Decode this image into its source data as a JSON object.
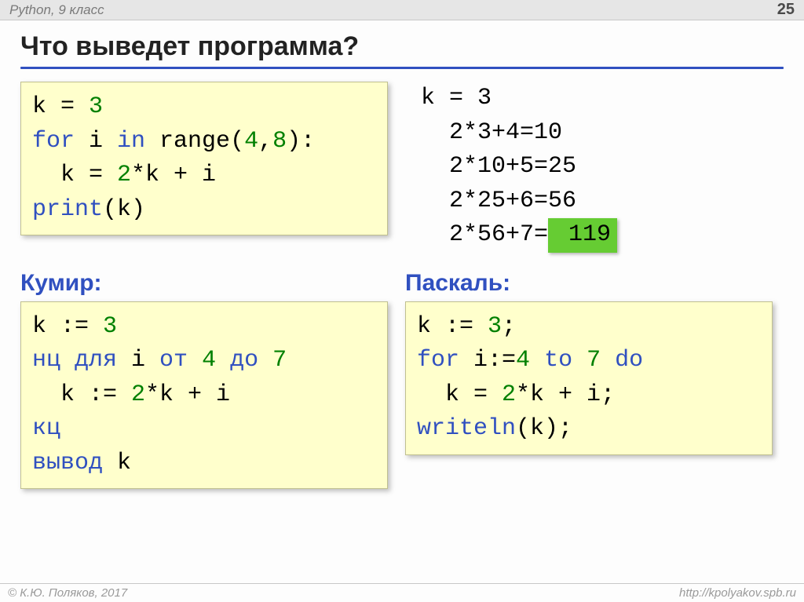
{
  "topbar": {
    "course": "Python, 9 класс",
    "page": "25"
  },
  "title": "Что выведет программа?",
  "python": {
    "l1_a": "k = ",
    "l1_b": "3",
    "l2_a": "for",
    "l2_b": " i ",
    "l2_c": "in",
    "l2_d": " range(",
    "l2_e": "4",
    "l2_f": ",",
    "l2_g": "8",
    "l2_h": "):",
    "l3_a": "  k = ",
    "l3_b": "2",
    "l3_c": "*k + i",
    "l4_a": "print",
    "l4_b": "(k)"
  },
  "trace": {
    "l1": "k = 3",
    "l2": "  2*3+4=10",
    "l3": "  2*10+5=25",
    "l4": "  2*25+6=56",
    "l5a": "  2*56+7=",
    "answer": " 119"
  },
  "kumir_label": "Кумир:",
  "kumir": {
    "l1_a": "k := ",
    "l1_b": "3",
    "l2_a": "нц для",
    "l2_b": " i ",
    "l2_c": "от",
    "l2_d": " ",
    "l2_e": "4",
    "l2_f": " ",
    "l2_g": "до",
    "l2_h": " ",
    "l2_i": "7",
    "l3_a": "  k := ",
    "l3_b": "2",
    "l3_c": "*k + i",
    "l4": "кц",
    "l5_a": "вывод",
    "l5_b": " k"
  },
  "pascal_label": "Паскаль:",
  "pascal": {
    "l1_a": "k := ",
    "l1_b": "3",
    "l1_c": ";",
    "l2_a": "for",
    "l2_b": " i:=",
    "l2_c": "4",
    "l2_d": " ",
    "l2_e": "to",
    "l2_f": " ",
    "l2_g": "7",
    "l2_h": " ",
    "l2_i": "do",
    "l3_a": "  k = ",
    "l3_b": "2",
    "l3_c": "*k + i;",
    "l4_a": "writeln",
    "l4_b": "(k);"
  },
  "footer": {
    "left": "© К.Ю. Поляков, 2017",
    "right": "http://kpolyakov.spb.ru"
  }
}
